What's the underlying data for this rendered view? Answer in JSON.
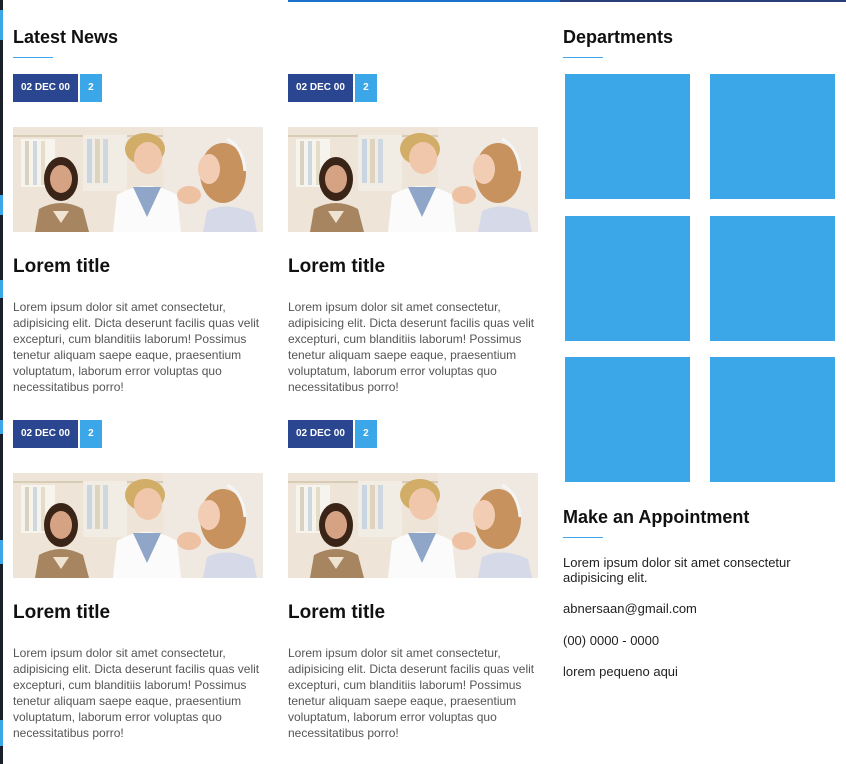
{
  "latest_news": {
    "title": "Latest News",
    "posts": [
      {
        "date": "02 DEC 00",
        "count": "2",
        "title": "Lorem title",
        "text": "Lorem ipsum dolor sit amet consectetur, adipisicing elit. Dicta deserunt facilis quas velit excepturi, cum blanditiis laborum! Possimus tenetur aliquam saepe eaque, praesentium voluptatum, laborum error voluptas quo necessitatibus porro!"
      },
      {
        "date": "02 DEC 00",
        "count": "2",
        "title": "Lorem title",
        "text": "Lorem ipsum dolor sit amet consectetur, adipisicing elit. Dicta deserunt facilis quas velit excepturi, cum blanditiis laborum! Possimus tenetur aliquam saepe eaque, praesentium voluptatum, laborum error voluptas quo necessitatibus porro!"
      },
      {
        "date": "02 DEC 00",
        "count": "2",
        "title": "Lorem title",
        "text": "Lorem ipsum dolor sit amet consectetur, adipisicing elit. Dicta deserunt facilis quas velit excepturi, cum blanditiis laborum! Possimus tenetur aliquam saepe eaque, praesentium voluptatum, laborum error voluptas quo necessitatibus porro!"
      },
      {
        "date": "02 DEC 00",
        "count": "2",
        "title": "Lorem title",
        "text": "Lorem ipsum dolor sit amet consectetur, adipisicing elit. Dicta deserunt facilis quas velit excepturi, cum blanditiis laborum! Possimus tenetur aliquam saepe eaque, praesentium voluptatum, laborum error voluptas quo necessitatibus porro!"
      }
    ]
  },
  "departments": {
    "title": "Departments",
    "tile_count": 6
  },
  "appointment": {
    "title": "Make an Appointment",
    "description": "Lorem ipsum dolor sit amet consectetur adipisicing elit.",
    "email": "abnersaan@gmail.com",
    "phone": "(00) 0000 - 0000",
    "note": "lorem pequeno aqui"
  },
  "colors": {
    "accent": "#3ba7e8",
    "date_badge": "#2b4690",
    "tile": "#3ba7e8"
  }
}
